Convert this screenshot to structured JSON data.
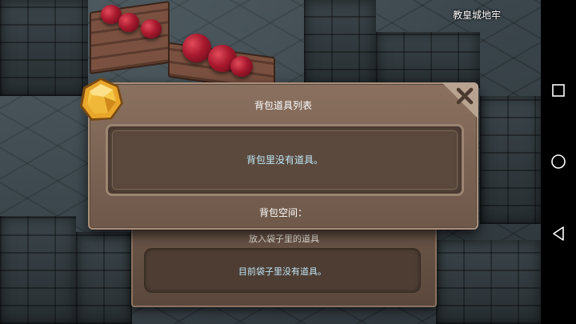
{
  "scene": {
    "location_name": "教皇城地牢"
  },
  "dialog": {
    "title": "背包道具列表",
    "empty_message": "背包里没有道具。",
    "capacity_label": "背包空间：",
    "close_icon": "close-x-icon",
    "badge_icon": "gold-gem-icon"
  },
  "bag_panel": {
    "header": "放入袋子里的道具",
    "empty_message": "目前袋子里没有道具。"
  },
  "navbar": {
    "buttons": [
      "recent-apps-square-icon",
      "home-circle-icon",
      "back-triangle-icon"
    ]
  },
  "colors": {
    "panel_brown": "#7a6253",
    "empty_text_cyan": "#bfe9f6",
    "gem_gold": "#e8a62a"
  }
}
